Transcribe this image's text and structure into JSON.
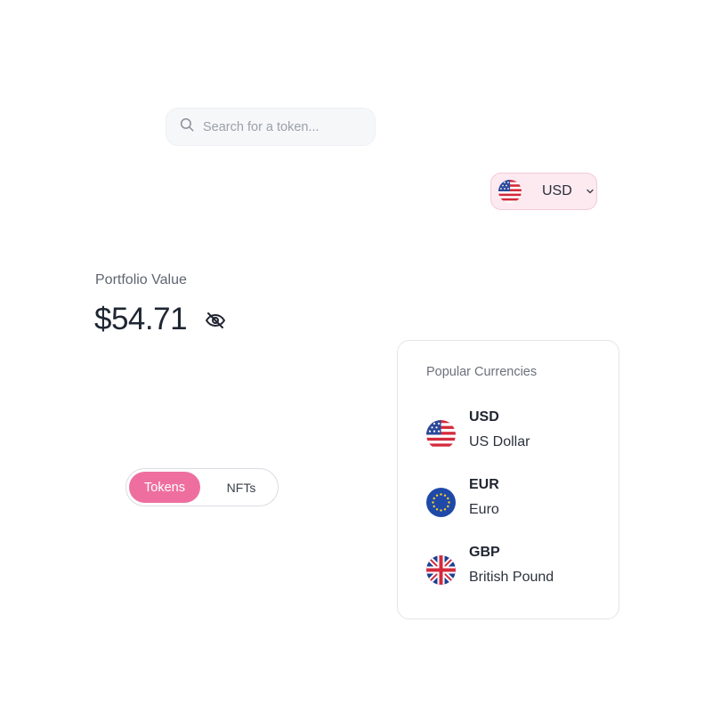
{
  "search": {
    "placeholder": "Search for a token...",
    "icon": "search-icon"
  },
  "currency_selector": {
    "selected_code": "USD",
    "flag": "us-flag-icon",
    "chevron": "chevron-down-icon"
  },
  "portfolio": {
    "label": "Portfolio Value",
    "value": "$54.71",
    "visibility_icon": "eye-off-icon"
  },
  "tabs": {
    "items": [
      "Tokens",
      "NFTs"
    ],
    "active": "Tokens"
  },
  "currency_dropdown": {
    "title": "Popular Currencies",
    "items": [
      {
        "code": "USD",
        "name": "US Dollar",
        "flag": "us-flag-icon"
      },
      {
        "code": "EUR",
        "name": "Euro",
        "flag": "eu-flag-icon"
      },
      {
        "code": "GBP",
        "name": "British Pound",
        "flag": "uk-flag-icon"
      }
    ]
  },
  "colors": {
    "accent": "#ee6f9f",
    "selector_bg": "#fdeaf1",
    "text": "#1f2430",
    "muted": "#6b707b"
  }
}
